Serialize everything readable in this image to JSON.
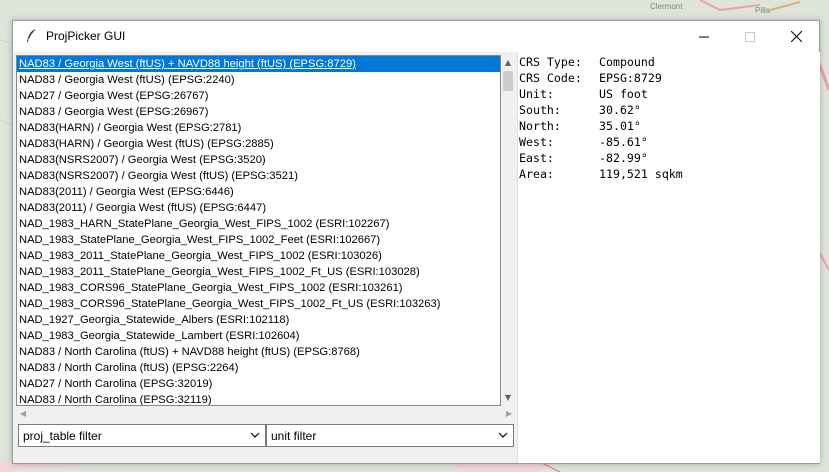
{
  "window": {
    "title": "ProjPicker GUI",
    "controls": {
      "minimize": "minimize",
      "maximize": "maximize",
      "close": "close"
    }
  },
  "map_labels": {
    "top_right_1": "Clermont",
    "top_right_2": "Pilla"
  },
  "crs_list": {
    "selected_index": 0,
    "items": [
      "NAD83 / Georgia West (ftUS) + NAVD88 height (ftUS) (EPSG:8729)",
      "NAD83 / Georgia West (ftUS) (EPSG:2240)",
      "NAD27 / Georgia West (EPSG:26767)",
      "NAD83 / Georgia West (EPSG:26967)",
      "NAD83(HARN) / Georgia West (EPSG:2781)",
      "NAD83(HARN) / Georgia West (ftUS) (EPSG:2885)",
      "NAD83(NSRS2007) / Georgia West (EPSG:3520)",
      "NAD83(NSRS2007) / Georgia West (ftUS) (EPSG:3521)",
      "NAD83(2011) / Georgia West (EPSG:6446)",
      "NAD83(2011) / Georgia West (ftUS) (EPSG:6447)",
      "NAD_1983_HARN_StatePlane_Georgia_West_FIPS_1002 (ESRI:102267)",
      "NAD_1983_StatePlane_Georgia_West_FIPS_1002_Feet (ESRI:102667)",
      "NAD_1983_2011_StatePlane_Georgia_West_FIPS_1002 (ESRI:103026)",
      "NAD_1983_2011_StatePlane_Georgia_West_FIPS_1002_Ft_US (ESRI:103028)",
      "NAD_1983_CORS96_StatePlane_Georgia_West_FIPS_1002 (ESRI:103261)",
      "NAD_1983_CORS96_StatePlane_Georgia_West_FIPS_1002_Ft_US (ESRI:103263)",
      "NAD_1927_Georgia_Statewide_Albers (ESRI:102118)",
      "NAD_1983_Georgia_Statewide_Lambert (ESRI:102604)",
      "NAD83 / North Carolina (ftUS) + NAVD88 height (ftUS) (EPSG:8768)",
      "NAD83 / North Carolina (ftUS) (EPSG:2264)",
      "NAD27 / North Carolina (EPSG:32019)",
      "NAD83 / North Carolina (EPSG:32119)"
    ]
  },
  "filters": {
    "proj_table": {
      "value": "proj_table filter"
    },
    "unit": {
      "value": "unit filter"
    }
  },
  "crs_info": {
    "rows": [
      {
        "key": "CRS Type:",
        "value": "Compound"
      },
      {
        "key": "CRS Code:",
        "value": "EPSG:8729"
      },
      {
        "key": "Unit:",
        "value": "US foot"
      },
      {
        "key": "South:",
        "value": "30.62°"
      },
      {
        "key": "North:",
        "value": "35.01°"
      },
      {
        "key": "West:",
        "value": "-85.61°"
      },
      {
        "key": "East:",
        "value": "-82.99°"
      },
      {
        "key": "Area:",
        "value": "119,521 sqkm"
      }
    ]
  },
  "colors": {
    "selection": "#0078d7",
    "window_bg": "#f0f0f0",
    "map_bg": "#dfe4da",
    "map_road": "#e7a2a6"
  }
}
